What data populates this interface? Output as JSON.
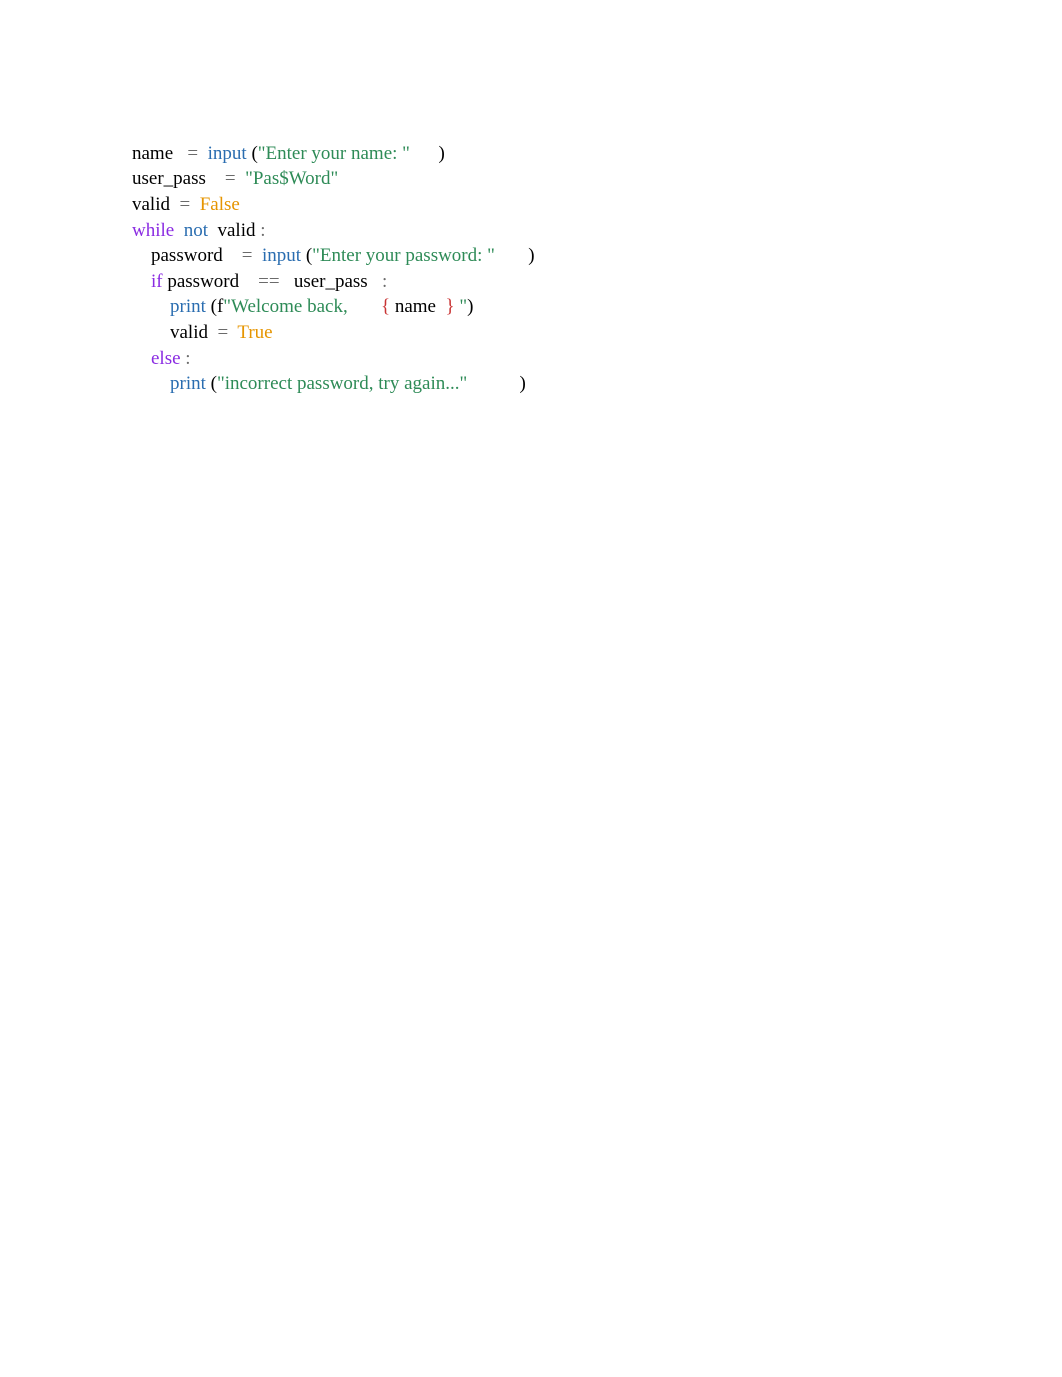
{
  "code": {
    "l1": {
      "name": "name",
      "eq": "=",
      "input": "input",
      "lp": "(",
      "str": "\"Enter your name: \"",
      "rp": ")"
    },
    "l2": {
      "var": "user_pass",
      "eq": "=",
      "str": "\"Pas$Word\""
    },
    "l3": {
      "var": "valid",
      "eq": "=",
      "val": "False"
    },
    "l4": {
      "kw": "while",
      "not": "not",
      "var": "valid",
      "colon": ":"
    },
    "l5": {
      "var": "password",
      "eq": "=",
      "input": "input",
      "lp": "(",
      "str": "\"Enter your password: \"",
      "rp": ")"
    },
    "l6": {
      "kw": "if",
      "lhs": "password",
      "op": "==",
      "rhs": "user_pass",
      "colon": ":"
    },
    "l7": {
      "print": "print",
      "lp": "(",
      "fpre": "f",
      "s1": "\"Welcome back, ",
      "lb": "{",
      "var": "name",
      "rb": "}",
      "s2": "\"",
      "rp": ")"
    },
    "l8": {
      "var": "valid",
      "eq": "=",
      "val": "True"
    },
    "l9": {
      "kw": "else",
      "colon": ":"
    },
    "l10": {
      "print": "print",
      "lp": "(",
      "str": "\"incorrect password, try again...\"",
      "rp": ")"
    }
  }
}
